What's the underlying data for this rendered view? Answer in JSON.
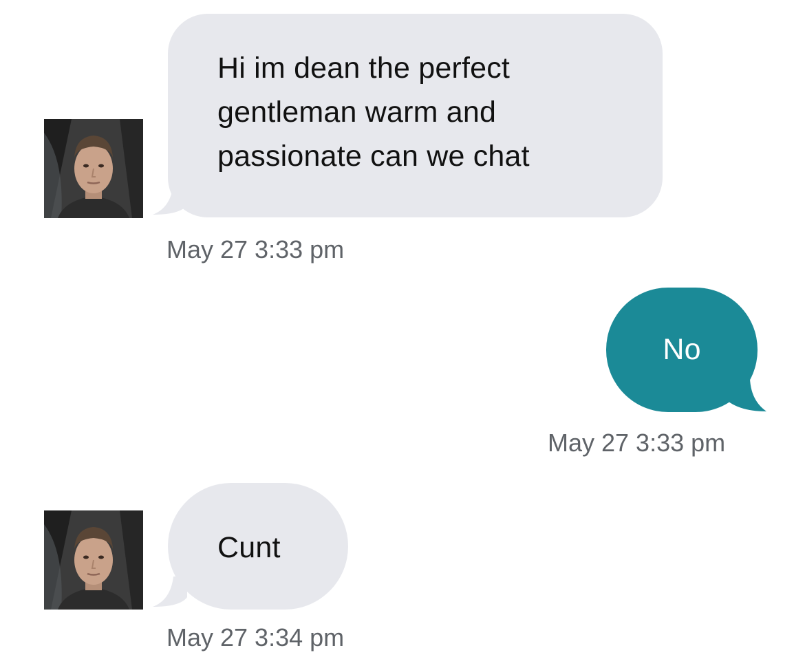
{
  "colors": {
    "incoming_bubble": "#e7e8ed",
    "outgoing_bubble": "#1b8a97",
    "timestamp_text": "#5f6368",
    "background": "#ffffff"
  },
  "messages": [
    {
      "direction": "incoming",
      "has_avatar": true,
      "lines": [
        "Hi im dean the perfect",
        "gentleman warm and",
        "passionate can we chat"
      ],
      "timestamp": "May 27 3:33 pm"
    },
    {
      "direction": "outgoing",
      "has_avatar": false,
      "lines": [
        "No"
      ],
      "timestamp": "May 27 3:33 pm"
    },
    {
      "direction": "incoming",
      "has_avatar": true,
      "lines": [
        "Cunt"
      ],
      "timestamp": "May 27 3:34 pm"
    }
  ]
}
